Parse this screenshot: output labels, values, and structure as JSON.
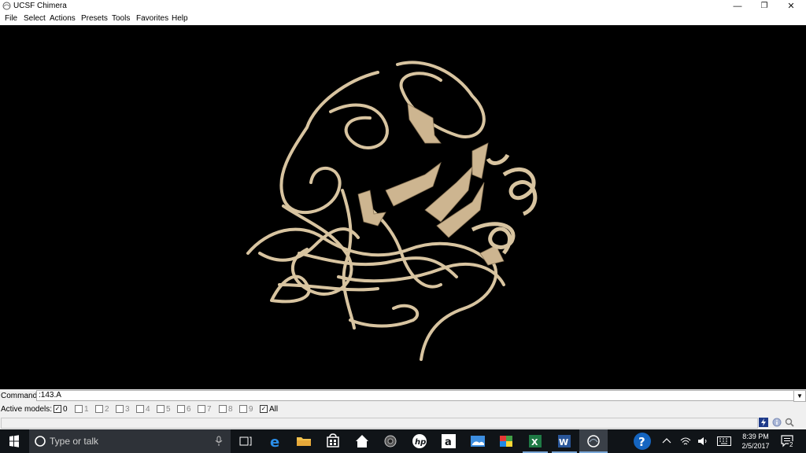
{
  "window": {
    "title": "UCSF Chimera",
    "controls": {
      "minimize": "—",
      "restore": "❐",
      "close": "✕"
    }
  },
  "menu": [
    "File",
    "Select",
    "Actions",
    "Presets",
    "Tools",
    "Favorites",
    "Help"
  ],
  "command": {
    "label": "Command:",
    "value": ":143.A"
  },
  "active_models": {
    "label": "Active models:",
    "models": [
      {
        "label": "0",
        "checked": true
      },
      {
        "label": "1",
        "checked": false
      },
      {
        "label": "2",
        "checked": false
      },
      {
        "label": "3",
        "checked": false
      },
      {
        "label": "4",
        "checked": false
      },
      {
        "label": "5",
        "checked": false
      },
      {
        "label": "6",
        "checked": false
      },
      {
        "label": "7",
        "checked": false
      },
      {
        "label": "8",
        "checked": false
      },
      {
        "label": "9",
        "checked": false
      }
    ],
    "all": {
      "label": "All",
      "checked": true
    }
  },
  "viewport": {
    "background": "#000000",
    "ribbon_color": "#d8c4a0"
  },
  "taskbar": {
    "search_placeholder": "Type or talk",
    "time": "8:39 PM",
    "date": "2/5/2017",
    "notification_count": "2"
  }
}
